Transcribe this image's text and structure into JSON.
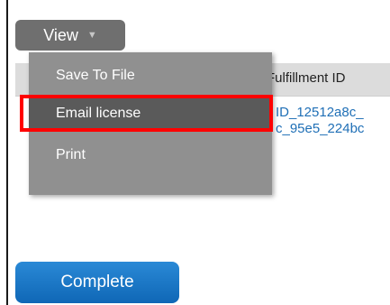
{
  "view_menu": {
    "label": "View",
    "caret_icon": "chevron-down-icon",
    "items": [
      {
        "label": "Save To File"
      },
      {
        "label": "Email license",
        "highlighted": true
      },
      {
        "label": "Print"
      }
    ]
  },
  "table": {
    "columns": [
      {
        "label": "Fulfillment ID"
      }
    ],
    "rows": [
      {
        "fulfillment_id": "ID_12512a8c_"
      },
      {
        "fulfillment_id": "c_95e5_224bc"
      }
    ]
  },
  "footer": {
    "complete_label": "Complete"
  },
  "colors": {
    "menu_bg": "#909090",
    "menu_selected_bg": "#5a5a5a",
    "highlight_border": "#ff0000",
    "link": "#1f6fb6",
    "primary_button": "#1a78c8"
  }
}
